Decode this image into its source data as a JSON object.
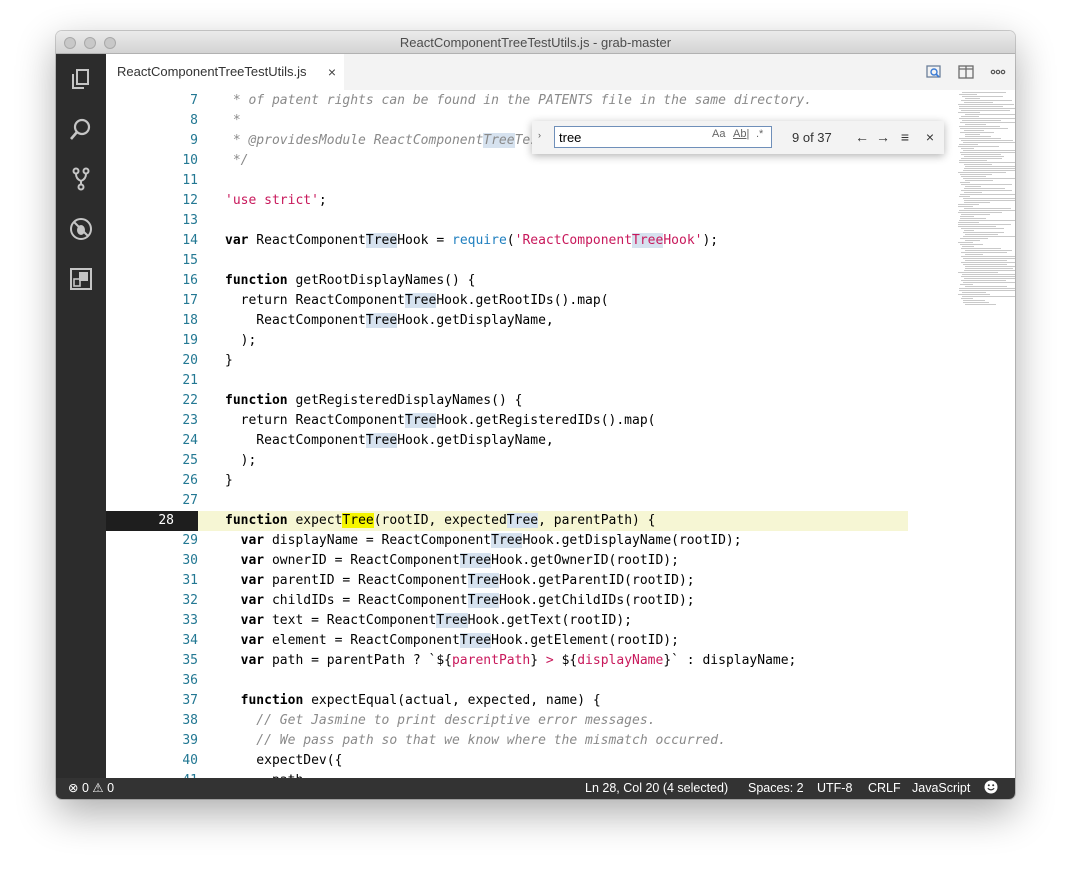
{
  "window": {
    "title": "ReactComponentTreeTestUtils.js - grab-master"
  },
  "activity_bar": {
    "icons": [
      "files-icon",
      "search-icon",
      "source-control-icon",
      "debug-icon",
      "extensions-icon"
    ]
  },
  "tabs": [
    {
      "label": "ReactComponentTreeTestUtils.js",
      "close": "×"
    }
  ],
  "tab_actions": [
    "open-preview-icon",
    "split-editor-icon",
    "more-icon"
  ],
  "find": {
    "toggle": "›",
    "value": "tree",
    "match_case": "Aa",
    "whole_word": "Ab|",
    "regex": ".*",
    "count": "9 of 37",
    "prev": "←",
    "next": "→",
    "selection": "≡",
    "close": "×"
  },
  "editor": {
    "lines": [
      {
        "n": "7",
        "parts": [
          [
            "cm",
            " * of patent rights can be found in the PATENTS file in the same directory."
          ]
        ]
      },
      {
        "n": "8",
        "parts": [
          [
            "cm",
            " *"
          ]
        ]
      },
      {
        "n": "9",
        "parts": [
          [
            "cm",
            " * @providesModule ReactComponent"
          ],
          [
            "cmhl",
            "Tree"
          ],
          [
            "cm",
            "TestUtils"
          ]
        ]
      },
      {
        "n": "10",
        "parts": [
          [
            "cm",
            " */"
          ]
        ]
      },
      {
        "n": "11",
        "parts": []
      },
      {
        "n": "12",
        "parts": [
          [
            "str",
            "'use strict'"
          ],
          [
            "p",
            ";"
          ]
        ]
      },
      {
        "n": "13",
        "parts": []
      },
      {
        "n": "14",
        "parts": [
          [
            "kw",
            "var"
          ],
          [
            "p",
            " ReactComponent"
          ],
          [
            "hl",
            "Tree"
          ],
          [
            "p",
            "Hook = "
          ],
          [
            "fn",
            "require"
          ],
          [
            "p",
            "("
          ],
          [
            "str",
            "'ReactComponent"
          ],
          [
            "strhl",
            "Tree"
          ],
          [
            "str",
            "Hook'"
          ],
          [
            "p",
            ");"
          ]
        ]
      },
      {
        "n": "15",
        "parts": []
      },
      {
        "n": "16",
        "parts": [
          [
            "kw",
            "function"
          ],
          [
            "p",
            " getRootDisplayNames() {"
          ]
        ]
      },
      {
        "n": "17",
        "parts": [
          [
            "p",
            "  return ReactComponent"
          ],
          [
            "hl",
            "Tree"
          ],
          [
            "p",
            "Hook.getRootIDs().map("
          ]
        ]
      },
      {
        "n": "18",
        "parts": [
          [
            "p",
            "    ReactComponent"
          ],
          [
            "hl",
            "Tree"
          ],
          [
            "p",
            "Hook.getDisplayName,"
          ]
        ]
      },
      {
        "n": "19",
        "parts": [
          [
            "p",
            "  );"
          ]
        ]
      },
      {
        "n": "20",
        "parts": [
          [
            "p",
            "}"
          ]
        ]
      },
      {
        "n": "21",
        "parts": []
      },
      {
        "n": "22",
        "parts": [
          [
            "kw",
            "function"
          ],
          [
            "p",
            " getRegisteredDisplayNames() {"
          ]
        ]
      },
      {
        "n": "23",
        "parts": [
          [
            "p",
            "  return ReactComponent"
          ],
          [
            "hl",
            "Tree"
          ],
          [
            "p",
            "Hook.getRegisteredIDs().map("
          ]
        ]
      },
      {
        "n": "24",
        "parts": [
          [
            "p",
            "    ReactComponent"
          ],
          [
            "hl",
            "Tree"
          ],
          [
            "p",
            "Hook.getDisplayName,"
          ]
        ]
      },
      {
        "n": "25",
        "parts": [
          [
            "p",
            "  );"
          ]
        ]
      },
      {
        "n": "26",
        "parts": [
          [
            "p",
            "}"
          ]
        ]
      },
      {
        "n": "27",
        "parts": []
      },
      {
        "n": "28",
        "current": true,
        "parts": [
          [
            "kw",
            "function"
          ],
          [
            "p",
            " expect"
          ],
          [
            "hlc",
            "Tree"
          ],
          [
            "p",
            "(rootID, expected"
          ],
          [
            "hl",
            "Tree"
          ],
          [
            "p",
            ", parentPath) {"
          ]
        ]
      },
      {
        "n": "29",
        "parts": [
          [
            "p",
            "  "
          ],
          [
            "kw",
            "var"
          ],
          [
            "p",
            " displayName = ReactComponent"
          ],
          [
            "hl",
            "Tree"
          ],
          [
            "p",
            "Hook.getDisplayName(rootID);"
          ]
        ]
      },
      {
        "n": "30",
        "parts": [
          [
            "p",
            "  "
          ],
          [
            "kw",
            "var"
          ],
          [
            "p",
            " ownerID = ReactComponent"
          ],
          [
            "hl",
            "Tree"
          ],
          [
            "p",
            "Hook.getOwnerID(rootID);"
          ]
        ]
      },
      {
        "n": "31",
        "parts": [
          [
            "p",
            "  "
          ],
          [
            "kw",
            "var"
          ],
          [
            "p",
            " parentID = ReactComponent"
          ],
          [
            "hl",
            "Tree"
          ],
          [
            "p",
            "Hook.getParentID(rootID);"
          ]
        ]
      },
      {
        "n": "32",
        "parts": [
          [
            "p",
            "  "
          ],
          [
            "kw",
            "var"
          ],
          [
            "p",
            " childIDs = ReactComponent"
          ],
          [
            "hl",
            "Tree"
          ],
          [
            "p",
            "Hook.getChildIDs(rootID);"
          ]
        ]
      },
      {
        "n": "33",
        "parts": [
          [
            "p",
            "  "
          ],
          [
            "kw",
            "var"
          ],
          [
            "p",
            " text = ReactComponent"
          ],
          [
            "hl",
            "Tree"
          ],
          [
            "p",
            "Hook.getText(rootID);"
          ]
        ]
      },
      {
        "n": "34",
        "parts": [
          [
            "p",
            "  "
          ],
          [
            "kw",
            "var"
          ],
          [
            "p",
            " element = ReactComponent"
          ],
          [
            "hl",
            "Tree"
          ],
          [
            "p",
            "Hook.getElement(rootID);"
          ]
        ]
      },
      {
        "n": "35",
        "parts": [
          [
            "p",
            "  "
          ],
          [
            "kw",
            "var"
          ],
          [
            "p",
            " path = parentPath ? `${"
          ],
          [
            "str",
            "parentPath"
          ],
          [
            "p",
            "} "
          ],
          [
            "str",
            ">"
          ],
          [
            "p",
            " ${"
          ],
          [
            "str",
            "displayName"
          ],
          [
            "p",
            "}` : displayName;"
          ]
        ]
      },
      {
        "n": "36",
        "parts": []
      },
      {
        "n": "37",
        "parts": [
          [
            "p",
            "  "
          ],
          [
            "kw",
            "function"
          ],
          [
            "p",
            " expectEqual(actual, expected, name) {"
          ]
        ]
      },
      {
        "n": "38",
        "parts": [
          [
            "cm",
            "    // Get Jasmine to print descriptive error messages."
          ]
        ]
      },
      {
        "n": "39",
        "parts": [
          [
            "cm",
            "    // We pass path so that we know where the mismatch occurred."
          ]
        ]
      },
      {
        "n": "40",
        "parts": [
          [
            "p",
            "    expectDev({"
          ]
        ]
      },
      {
        "n": "41",
        "parts": [
          [
            "p",
            "      path,"
          ]
        ]
      }
    ]
  },
  "status": {
    "errors": "0",
    "warnings": "0",
    "position": "Ln 28, Col 20 (4 selected)",
    "spaces": "Spaces: 2",
    "encoding": "UTF-8",
    "eol": "CRLF",
    "language": "JavaScript"
  },
  "colors": {
    "statusbar": "#333333",
    "activitybar": "#2c2c2c",
    "match_highlight": "#d6e2ef",
    "current_match": "#f5f500",
    "current_line": "#f6f6d4"
  }
}
